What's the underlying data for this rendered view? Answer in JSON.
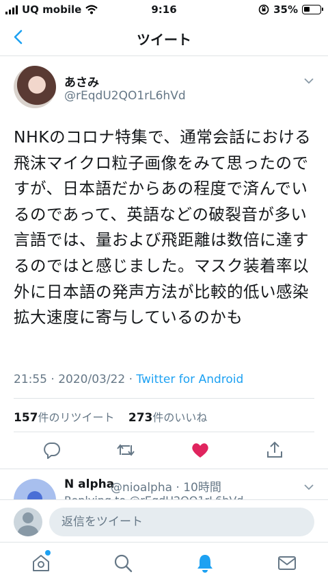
{
  "status_bar": {
    "carrier": "UQ mobile",
    "time": "9:16",
    "battery": "35%"
  },
  "header": {
    "title": "ツイート"
  },
  "tweet": {
    "author_name": "あさみ",
    "author_handle": "@rEqdU2QO1rL6hVd",
    "text": "NHKのコロナ特集で、通常会話における飛沫マイクロ粒子画像をみて思ったのですが、日本語だからあの程度で済んでいるのであって、英語などの破裂音が多い言語では、量および飛距離は数倍に達するのではと感じました。マスク装着率以外に日本語の発声方法が比較的低い感染拡大速度に寄与しているのかも",
    "timestamp": "21:55 · 2020/03/22 · ",
    "source": "Twitter for Android",
    "retweets_count": "157",
    "retweets_label": "件のリツイート",
    "likes_count": "273",
    "likes_label": "件のいいね"
  },
  "actions": [
    "reply-icon",
    "retweet-icon",
    "heart-icon",
    "share-icon"
  ],
  "reply_preview": {
    "name": "N alpha",
    "handle": "@nioalpha · 10時間",
    "line2": "Replying to @rEqdU2QO1rL6hVd"
  },
  "compose": {
    "placeholder": "返信をツイート"
  },
  "tabbar": [
    "home-icon",
    "search-icon",
    "notifications-icon",
    "messages-icon"
  ],
  "colors": {
    "accent": "#1da1f2",
    "like": "#e0245e",
    "muted": "#657786"
  }
}
